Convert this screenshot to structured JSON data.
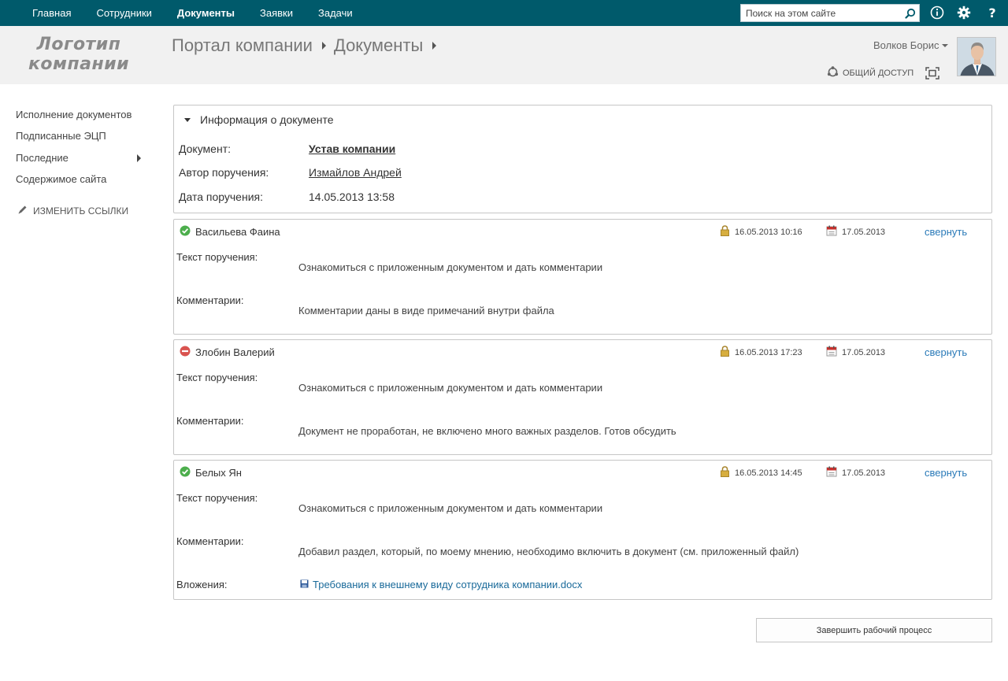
{
  "topnav": {
    "items": [
      {
        "label": "Главная",
        "active": false
      },
      {
        "label": "Сотрудники",
        "active": false
      },
      {
        "label": "Документы",
        "active": true
      },
      {
        "label": "Заявки",
        "active": false
      },
      {
        "label": "Задачи",
        "active": false
      }
    ],
    "search_placeholder": "Поиск на этом сайте",
    "icons": [
      "search-icon",
      "info-icon",
      "gear-icon",
      "help-icon"
    ]
  },
  "header": {
    "logo_line1": "Логотип",
    "logo_line2": "компании",
    "breadcrumb": [
      "Портал компании",
      "Документы"
    ],
    "user_name": "Волков Борис",
    "share_label": "ОБЩИЙ ДОСТУП"
  },
  "sidebar": {
    "items": [
      {
        "label": "Исполнение документов",
        "has_arrow": false
      },
      {
        "label": "Подписанные ЭЦП",
        "has_arrow": false
      },
      {
        "label": "Последние",
        "has_arrow": true
      },
      {
        "label": "Содержимое сайта",
        "has_arrow": false
      }
    ],
    "edit_links_label": "ИЗМЕНИТЬ ССЫЛКИ"
  },
  "document_info": {
    "title": "Информация о документе",
    "document_label": "Документ:",
    "document_value": "Устав компании",
    "author_label": "Автор поручения:",
    "author_value": "Измайлов Андрей",
    "date_label": "Дата поручения:",
    "date_value": "14.05.2013 13:58"
  },
  "tasks": [
    {
      "assignee": "Васильева Фаина",
      "status": "approved",
      "completed": "16.05.2013 10:16",
      "due": "17.05.2013",
      "collapse_label": "свернуть",
      "text_label": "Текст поручения:",
      "text": "Ознакомиться с приложенным документом и дать комментарии",
      "comment_label": "Комментарии:",
      "comment": "Комментарии даны в виде примечаний внутри файла"
    },
    {
      "assignee": "Злобин Валерий",
      "status": "rejected",
      "completed": "16.05.2013 17:23",
      "due": "17.05.2013",
      "collapse_label": "свернуть",
      "text_label": "Текст поручения:",
      "text": "Ознакомиться с приложенным документом и дать комментарии",
      "comment_label": "Комментарии:",
      "comment": "Документ не проработан, не включено много важных разделов. Готов обсудить"
    },
    {
      "assignee": "Белых Ян",
      "status": "approved",
      "completed": "16.05.2013 14:45",
      "due": "17.05.2013",
      "collapse_label": "свернуть",
      "text_label": "Текст поручения:",
      "text": "Ознакомиться с приложенным документом и дать комментарии",
      "comment_label": "Комментарии:",
      "comment": "Добавил раздел, который, по  моему мнению, необходимо включить в документ (см. приложенный файл)",
      "attachments_label": "Вложения:",
      "attachment": "Требования к внешнему виду сотрудника компании.docx"
    }
  ],
  "finish_button": "Завершить рабочий процесс",
  "colors": {
    "topbar": "#005a6b",
    "header_band": "#f1f1f1",
    "link": "#2a7ab8",
    "approved": "#4cae4c",
    "rejected": "#d9534f"
  }
}
